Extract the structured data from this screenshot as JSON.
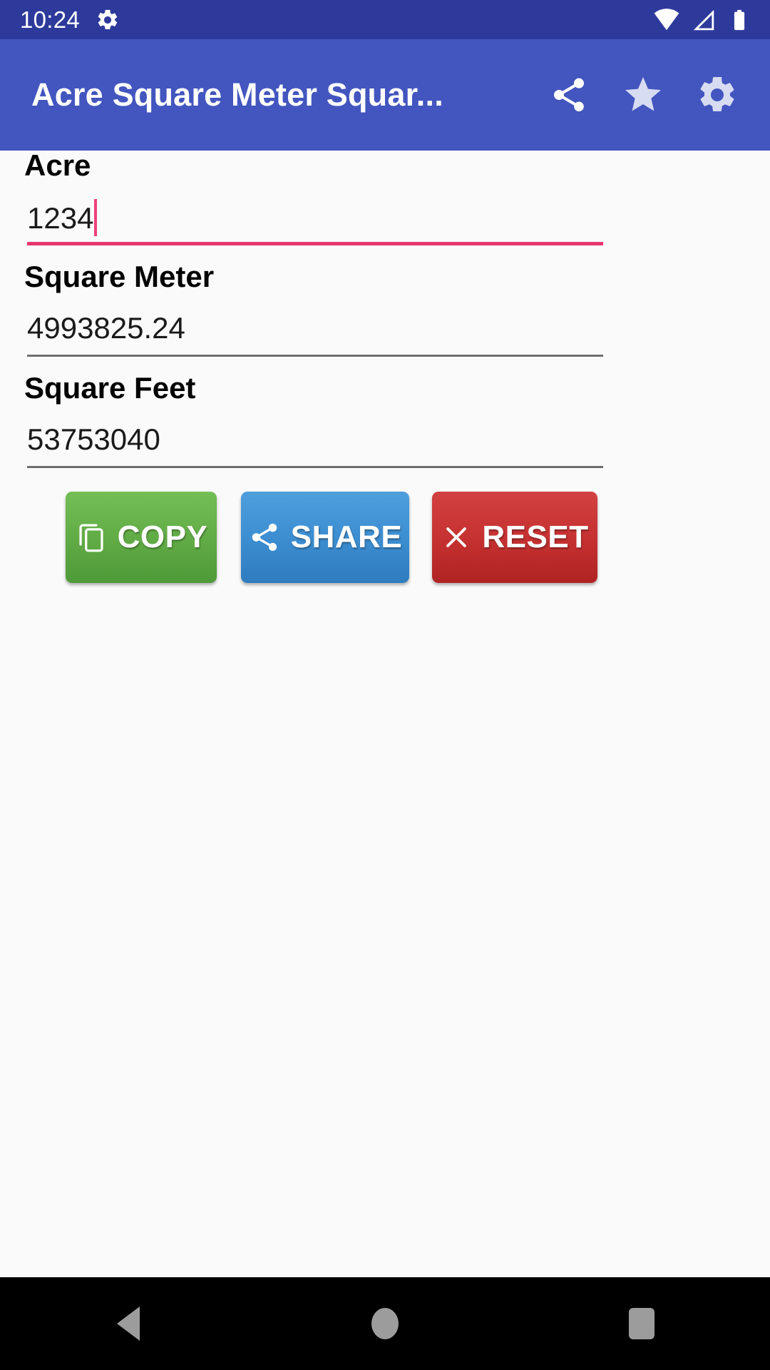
{
  "status_bar": {
    "time": "10:24",
    "icons": [
      "gear-icon",
      "wifi-icon",
      "cell-signal-icon",
      "battery-icon"
    ],
    "background_color": "#2d3a9b"
  },
  "app_bar": {
    "title": "Acre Square Meter Squar...",
    "background_color": "#4355bf",
    "actions": [
      {
        "name": "share-icon",
        "label": "Share"
      },
      {
        "name": "star-icon",
        "label": "Favorite"
      },
      {
        "name": "gear-icon",
        "label": "Settings"
      }
    ]
  },
  "form": {
    "fields": [
      {
        "label": "Acre",
        "value": "1234",
        "focused": true,
        "underline_color": "#e8376f"
      },
      {
        "label": "Square Meter",
        "value": "4993825.24",
        "focused": false,
        "underline_color": "#6e6e6e"
      },
      {
        "label": "Square Feet",
        "value": "53753040",
        "focused": false,
        "underline_color": "#6e6e6e"
      }
    ]
  },
  "buttons": {
    "copy": {
      "label": "COPY",
      "icon": "copy-icon",
      "color": "#63ad47"
    },
    "share": {
      "label": "SHARE",
      "icon": "share-icon",
      "color": "#3d8fd2"
    },
    "reset": {
      "label": "RESET",
      "icon": "close-x-icon",
      "color": "#c73232"
    }
  },
  "nav_bar": {
    "back": "Back",
    "home": "Home",
    "recents": "Recent apps",
    "background_color": "#000000"
  }
}
